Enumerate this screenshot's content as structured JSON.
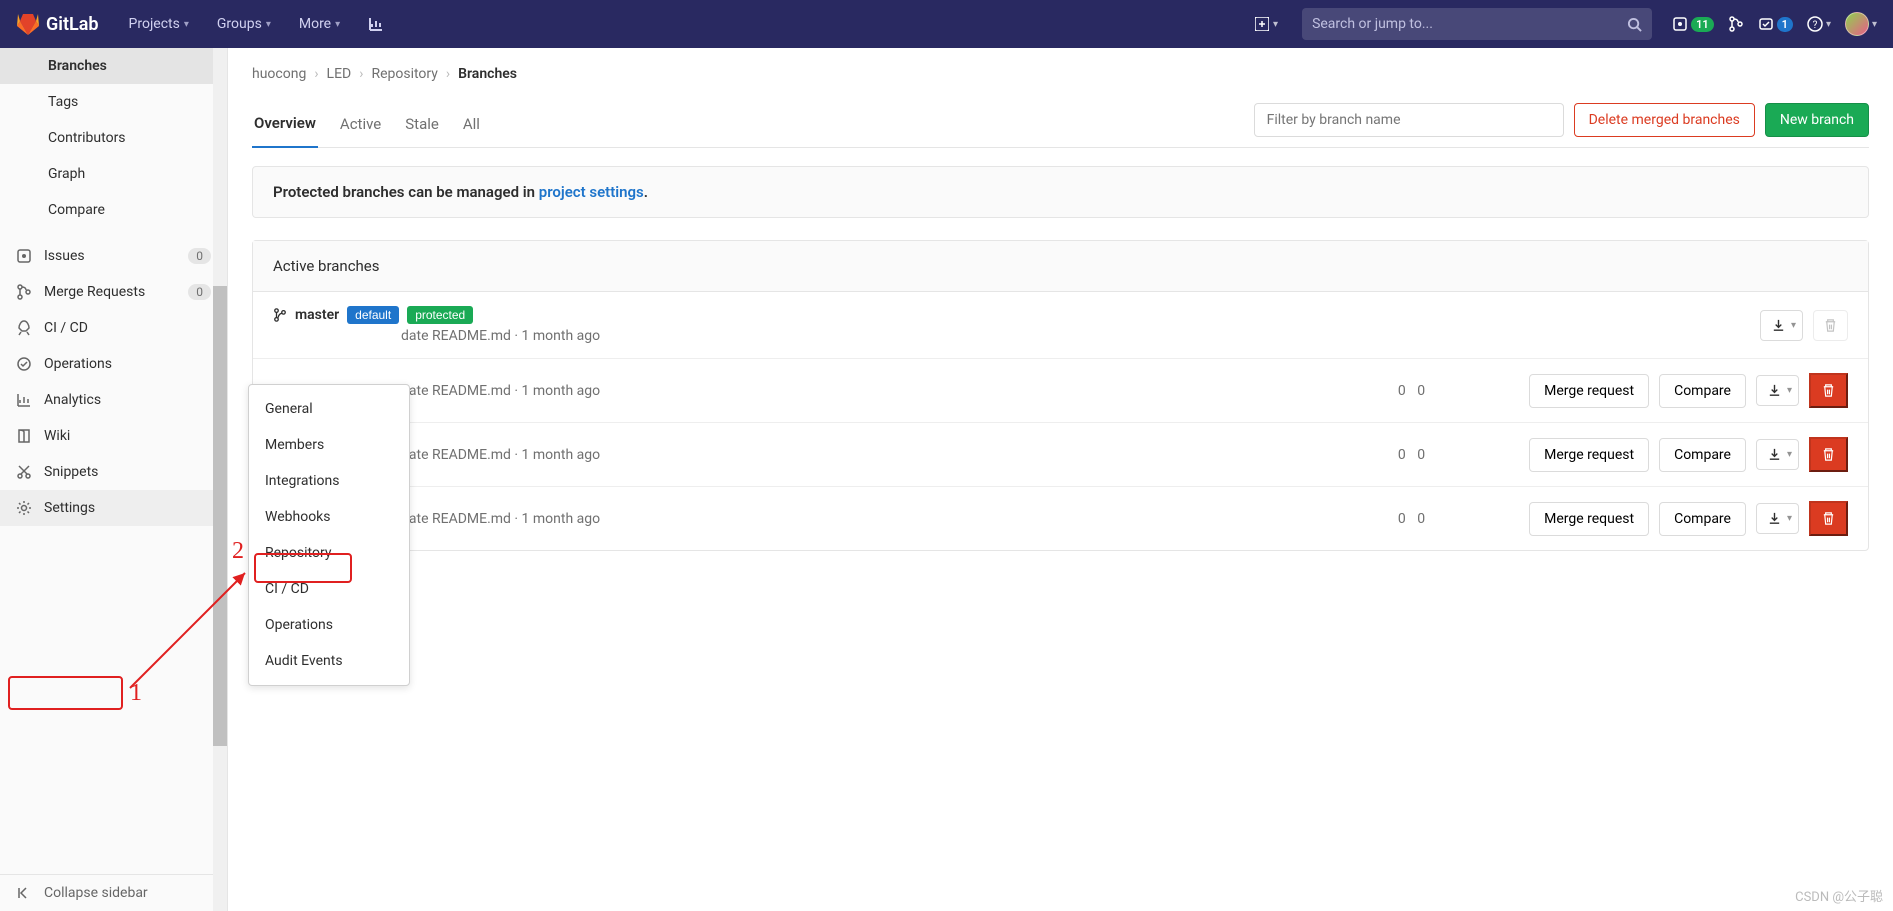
{
  "topbar": {
    "brand": "GitLab",
    "nav": {
      "projects": "Projects",
      "groups": "Groups",
      "more": "More"
    },
    "search_placeholder": "Search or jump to...",
    "badge_issues": "11",
    "badge_todos": "1"
  },
  "sidebar": {
    "sub": {
      "branches": "Branches",
      "tags": "Tags",
      "contributors": "Contributors",
      "graph": "Graph",
      "compare": "Compare"
    },
    "items": {
      "issues": "Issues",
      "issues_count": "0",
      "merge": "Merge Requests",
      "merge_count": "0",
      "cicd": "CI / CD",
      "operations": "Operations",
      "analytics": "Analytics",
      "wiki": "Wiki",
      "snippets": "Snippets",
      "settings": "Settings"
    },
    "collapse": "Collapse sidebar"
  },
  "breadcrumbs": {
    "p1": "huocong",
    "p2": "LED",
    "p3": "Repository",
    "p4": "Branches"
  },
  "tabs": {
    "overview": "Overview",
    "active": "Active",
    "stale": "Stale",
    "all": "All"
  },
  "actions": {
    "filter_placeholder": "Filter by branch name",
    "delete_merged": "Delete merged branches",
    "new_branch": "New branch"
  },
  "infobox": {
    "pre": "Protected branches can be managed in ",
    "link": "project settings",
    "post": "."
  },
  "panel": {
    "title": "Active branches",
    "master": {
      "name": "master",
      "tag_default": "default",
      "tag_protected": "protected",
      "sub": "date README.md · 1 month ago"
    },
    "rows": [
      {
        "sub": "date README.md · 1 month ago",
        "stats": "0 0",
        "merge": "Merge request",
        "compare": "Compare"
      },
      {
        "sub": "date README.md · 1 month ago",
        "stats": "0 0",
        "merge": "Merge request",
        "compare": "Compare"
      },
      {
        "sub": "date README.md · 1 month ago",
        "stats": "0 0",
        "merge": "Merge request",
        "compare": "Compare"
      }
    ]
  },
  "flyout": {
    "general": "General",
    "members": "Members",
    "integrations": "Integrations",
    "webhooks": "Webhooks",
    "repository": "Repository",
    "cicd": "CI / CD",
    "operations": "Operations",
    "audit": "Audit Events"
  },
  "anno": {
    "n1": "1",
    "n2": "2"
  },
  "watermark": "CSDN @公子聪"
}
